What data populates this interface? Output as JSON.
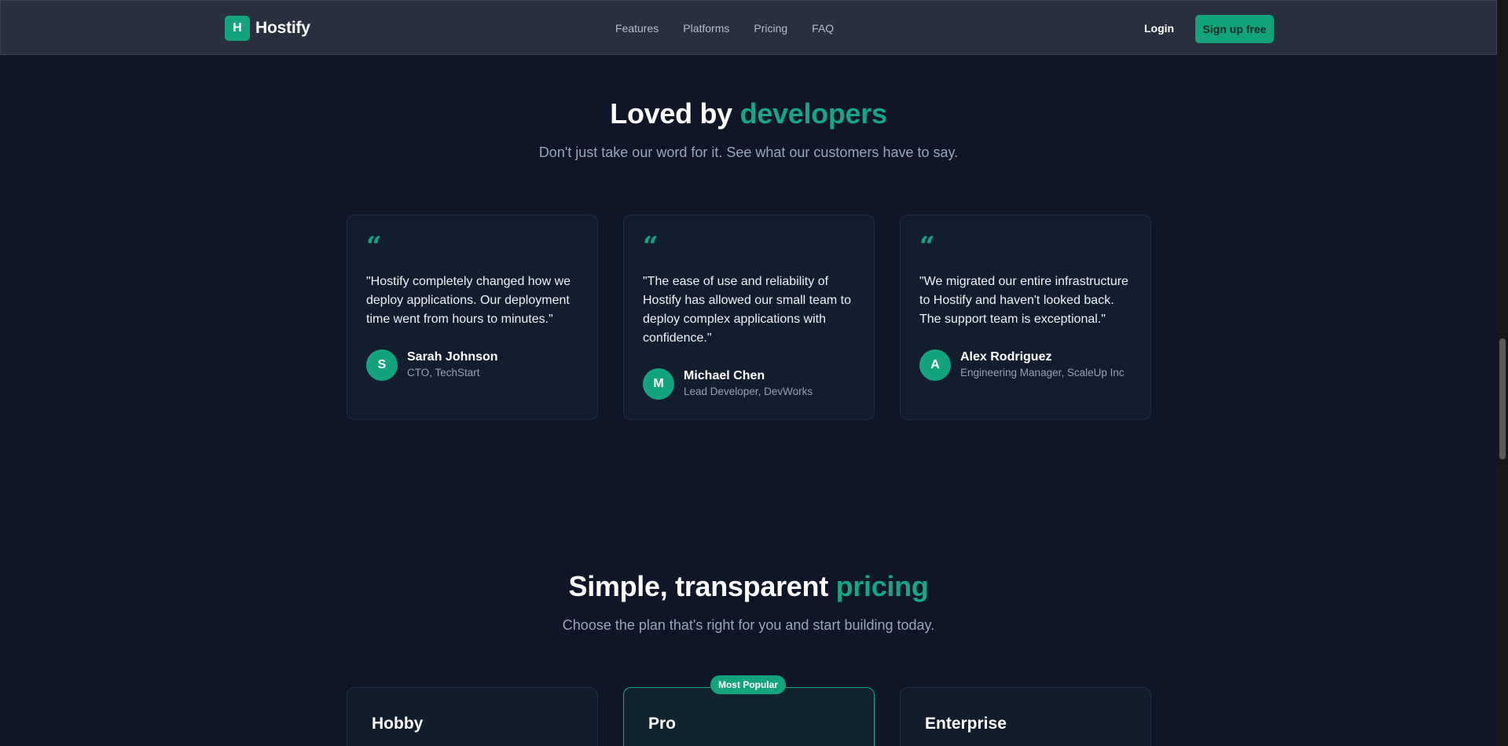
{
  "nav": {
    "brand_letter": "H",
    "brand_name": "Hostify",
    "links": [
      "Features",
      "Platforms",
      "Pricing",
      "FAQ"
    ],
    "login_label": "Login",
    "signup_label": "Sign up free"
  },
  "testimonials": {
    "heading_prefix": "Loved by",
    "heading_accent": "developers",
    "subheading": "Don't just take our word for it. See what our customers have to say.",
    "quote_glyph": "“",
    "items": [
      {
        "quote": "\"Hostify completely changed how we deploy applications. Our deployment time went from hours to minutes.\"",
        "initial": "S",
        "name": "Sarah Johnson",
        "role": "CTO, TechStart"
      },
      {
        "quote": "\"The ease of use and reliability of Hostify has allowed our small team to deploy complex applications with confidence.\"",
        "initial": "M",
        "name": "Michael Chen",
        "role": "Lead Developer, DevWorks"
      },
      {
        "quote": "\"We migrated our entire infrastructure to Hostify and haven't looked back. The support team is exceptional.\"",
        "initial": "A",
        "name": "Alex Rodriguez",
        "role": "Engineering Manager, ScaleUp Inc"
      }
    ]
  },
  "pricing": {
    "heading_prefix": "Simple, transparent",
    "heading_accent": "pricing",
    "subheading": "Choose the plan that's right for you and start building today.",
    "badge": "Most Popular",
    "plans": [
      {
        "name": "Hobby"
      },
      {
        "name": "Pro"
      },
      {
        "name": "Enterprise"
      }
    ]
  },
  "colors": {
    "background": "#0e1628",
    "accent": "#16a683",
    "card": "#131d30",
    "nav": "#283040"
  }
}
